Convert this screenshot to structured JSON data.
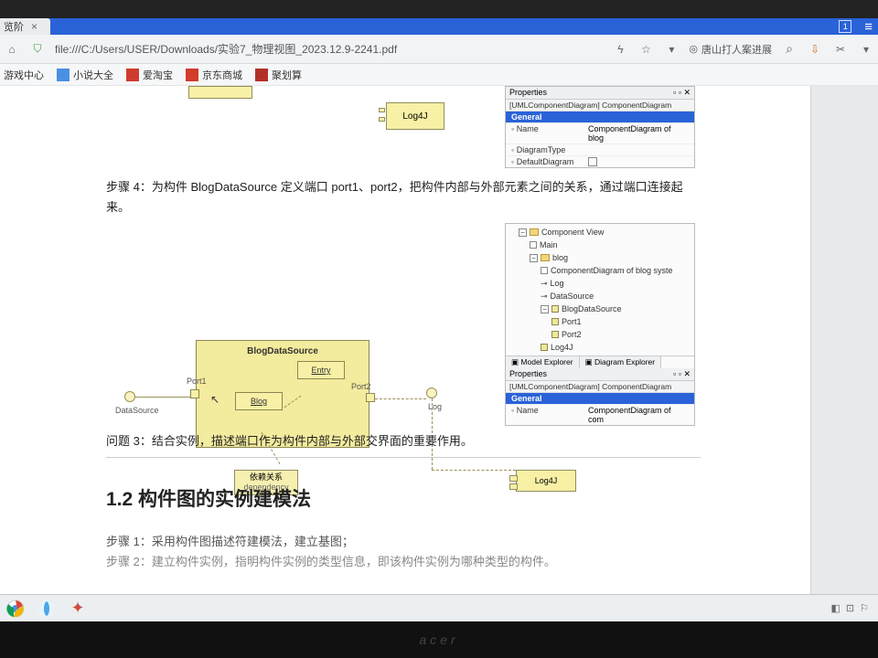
{
  "tab": {
    "title": "览阶",
    "close": "×",
    "count": "1"
  },
  "addr": {
    "url": "file:///C:/Users/USER/Downloads/实验7_物理视图_2023.12.9-2241.pdf",
    "ext_label": "唐山打人案进展"
  },
  "bookmarks": {
    "b1": "游戏中心",
    "b2": "小说大全",
    "b3": "爱淘宝",
    "b4": "京东商城",
    "b5": "聚划算"
  },
  "top_boxes": {
    "log4j": "Log4J"
  },
  "prop1": {
    "panel": "Properties",
    "sub": "[UMLComponentDiagram] ComponentDiagram",
    "group": "General",
    "r1k": "Name",
    "r1v": "ComponentDiagram of blog",
    "r2k": "DiagramType",
    "r3k": "DefaultDiagram"
  },
  "step4": "步骤 4：为构件 BlogDataSource 定义端口 port1、port2，把构件内部与外部元素之间的关系，通过端口连接起来。",
  "diag": {
    "bds": "BlogDataSource",
    "entry": "Entry",
    "blog": "Blog",
    "port1": "Port1",
    "port2": "Port2",
    "ds": "DataSource",
    "log": "Log",
    "log4j": "Log4J",
    "dep1": "依赖关系",
    "dep2": "dependency"
  },
  "tree": {
    "n0": "Component View",
    "n1": "Main",
    "n2": "blog",
    "n3": "ComponentDiagram of blog syste",
    "n4": "Log",
    "n5": "DataSource",
    "n6": "BlogDataSource",
    "n7": "Port1",
    "n8": "Port2",
    "n9": "Log4J",
    "tab_a": "Model Explorer",
    "tab_b": "Diagram Explorer"
  },
  "prop2": {
    "panel": "Properties",
    "sub": "[UMLComponentDiagram] ComponentDiagram",
    "group": "General",
    "r1k": "Name",
    "r1v": "ComponentDiagram of com"
  },
  "q3": "问题 3：结合实例，描述端口作为构件内部与外部交界面的重要作用。",
  "h12": "1.2 构件图的实例建模法",
  "s1": "步骤 1：采用构件图描述符建模法，建立基图；",
  "s2": "步骤 2：建立构件实例，指明构件实例的类型信息，即该构件实例为哪种类型的构件。",
  "bezel": "acer"
}
